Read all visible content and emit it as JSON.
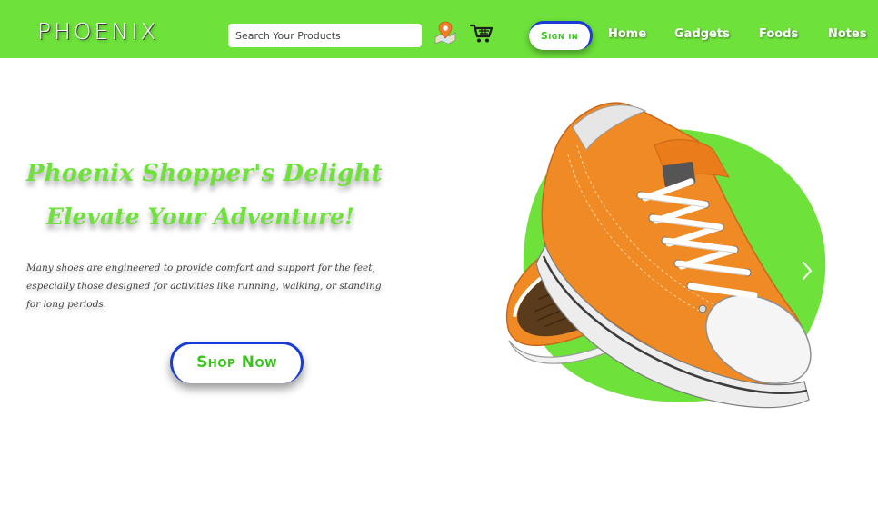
{
  "header": {
    "brand": "PHOENIX",
    "search_placeholder": "Search Your Products",
    "map_icon": "map-pin-icon",
    "cart_icon": "cart-icon",
    "signin_label": "Sign in",
    "nav": [
      {
        "label": "Home"
      },
      {
        "label": "Gadgets"
      },
      {
        "label": "Foods"
      },
      {
        "label": "Notes"
      }
    ]
  },
  "hero": {
    "title_line1": "Phoenix Shopper's Delight",
    "title_line2": "Elevate Your Adventure!",
    "description": "Many shoes are engineered to provide comfort and support for the feet, especially those designed for activities like running, walking, or standing for long periods.",
    "cta_label": "Shop Now",
    "image_icon": "orange-sneaker-image",
    "next_icon": "chevron-right-icon"
  },
  "colors": {
    "brand_green": "#6ee23b",
    "accent_blue": "#1a3bd6",
    "text_green": "#3bc41e",
    "shoe_orange": "#f08a24"
  }
}
